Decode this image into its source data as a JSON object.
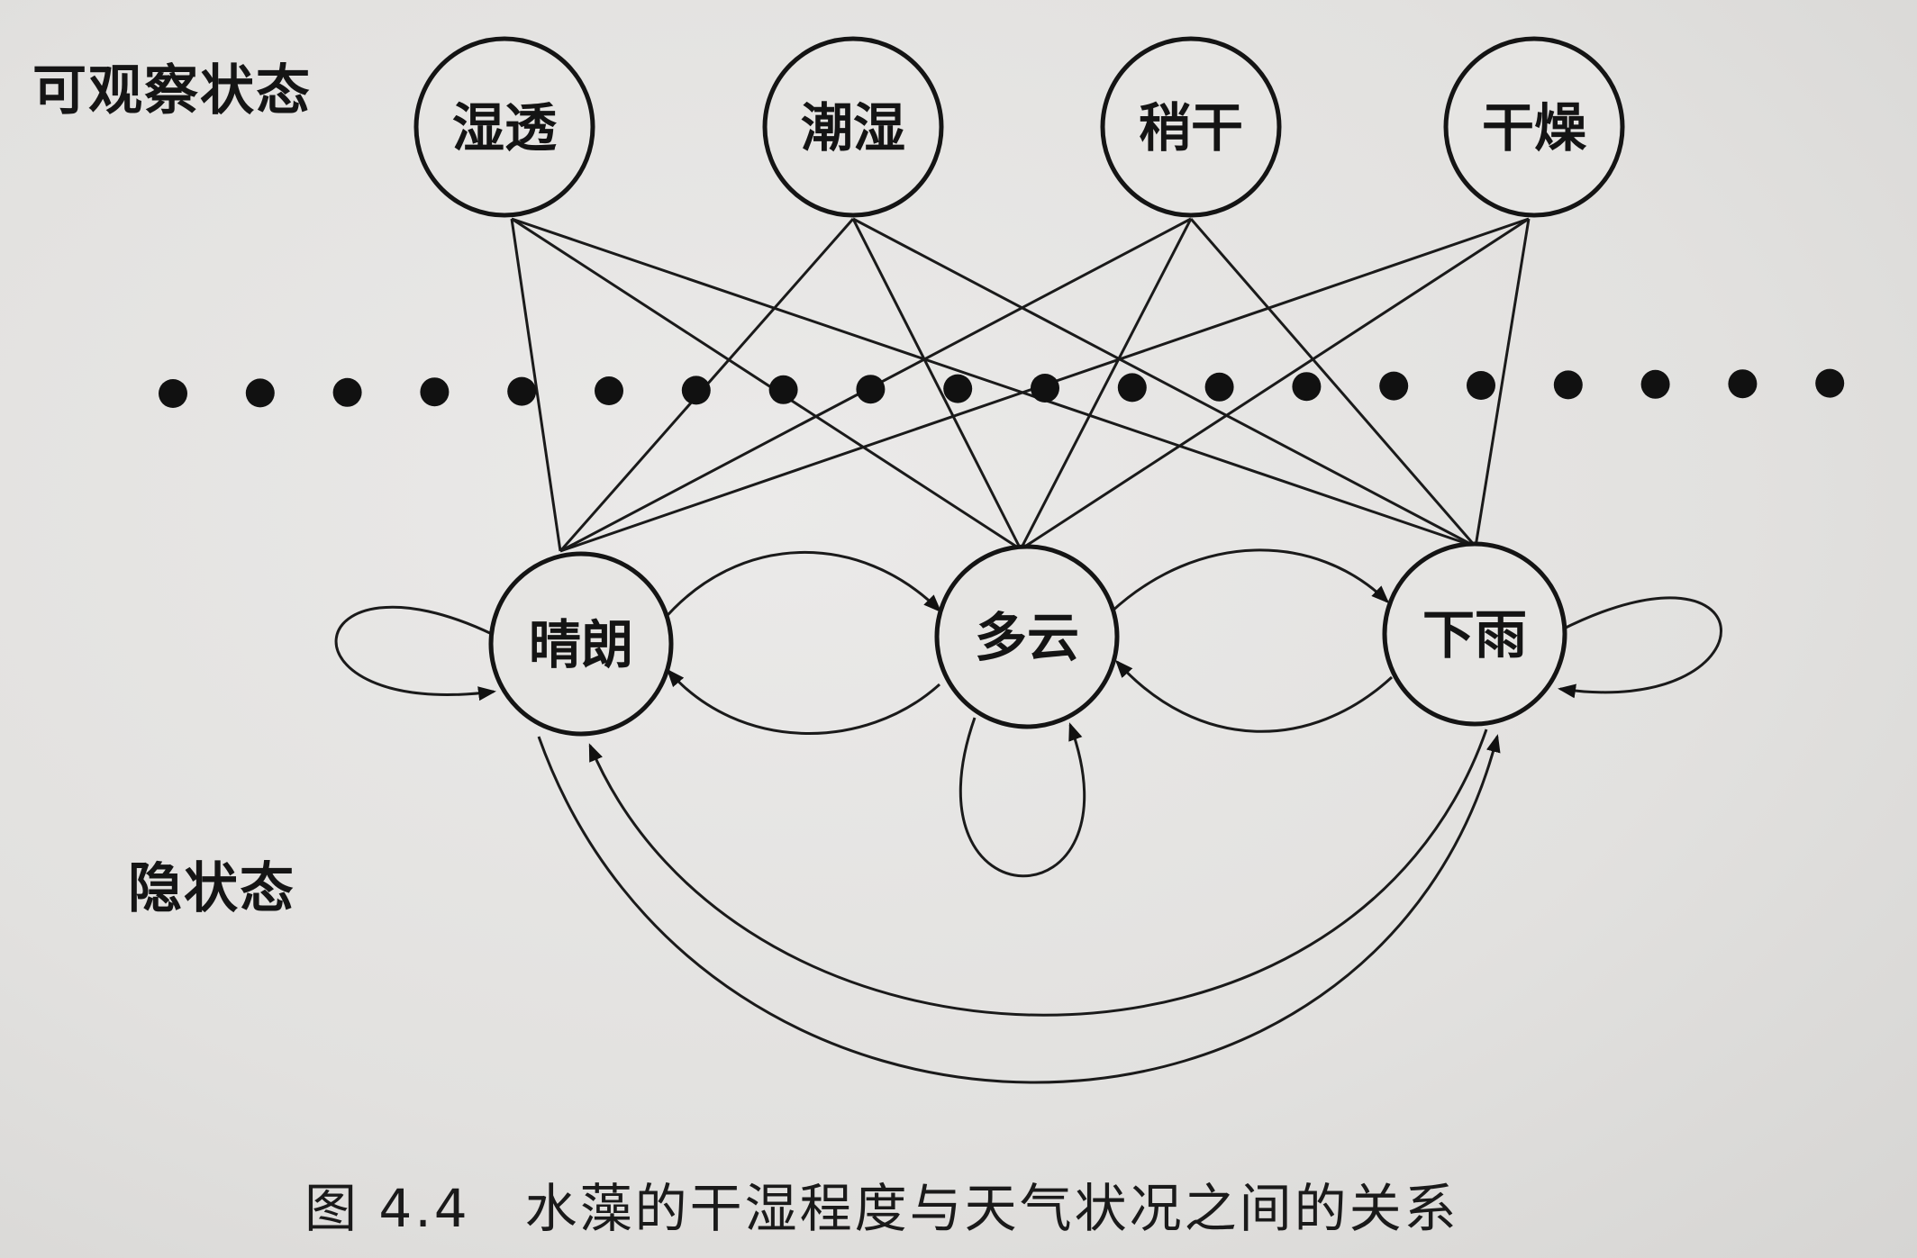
{
  "labels": {
    "observable": "可观察状态",
    "hidden": "隐状态",
    "caption": "图 4.4　水藻的干湿程度与天气状况之间的关系"
  },
  "observable_states": [
    "湿透",
    "潮湿",
    "稍干",
    "干燥"
  ],
  "hidden_states": [
    "晴朗",
    "多云",
    "下雨"
  ]
}
